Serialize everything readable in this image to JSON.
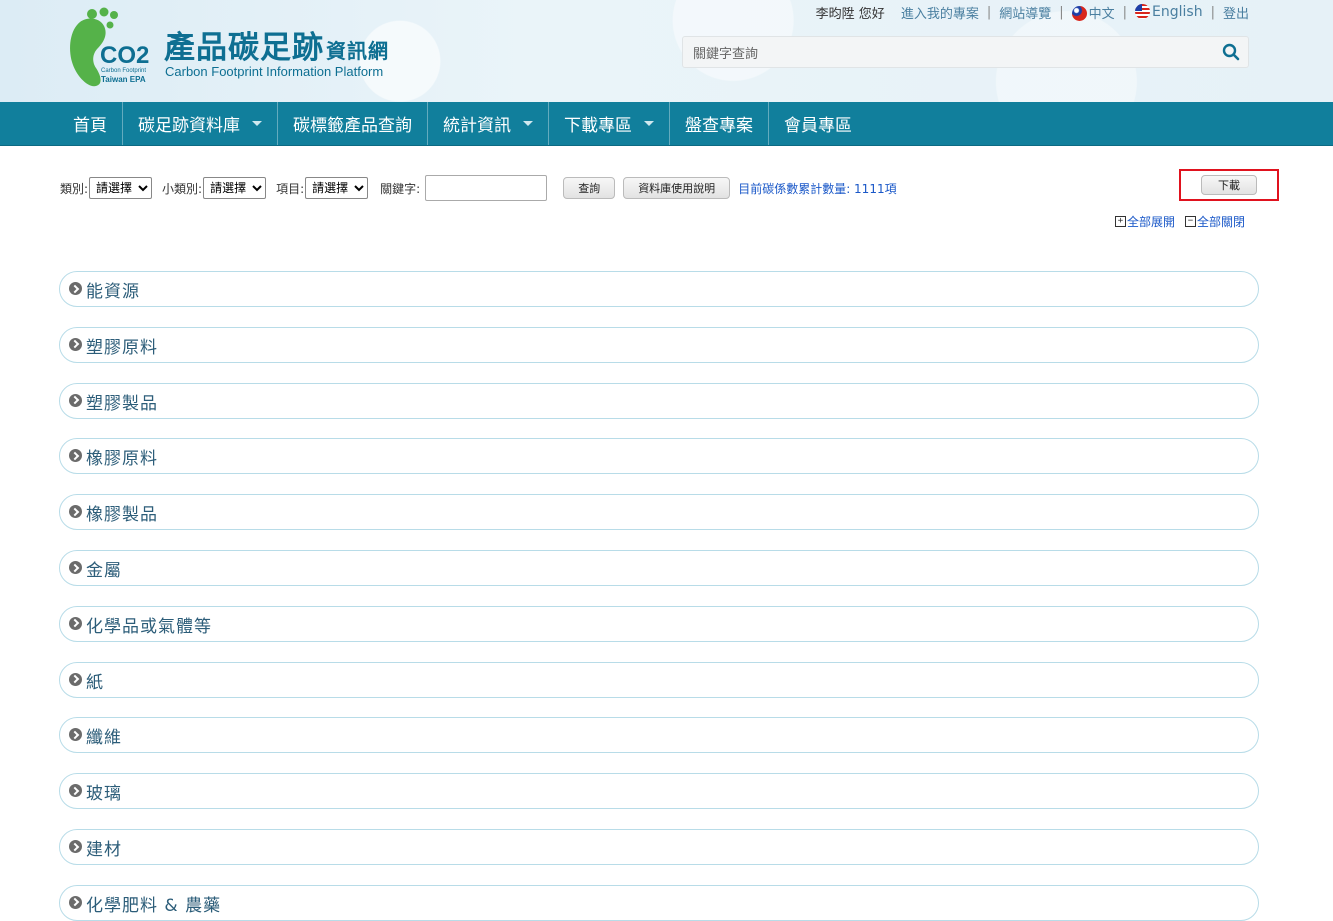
{
  "brand": {
    "title": "產品碳足跡",
    "title_suffix": "資訊網",
    "subtitle": "Carbon Footprint Information Platform",
    "logo_co2": "CO2",
    "logo_small1": "Carbon Footprint",
    "logo_small2": "Taiwan EPA"
  },
  "topnav": {
    "greeting": "李昀陞 您好",
    "my_project": "進入我的專案",
    "sitemap": "網站導覽",
    "chinese": "中文",
    "english": "English",
    "logout": "登出",
    "sep": "|"
  },
  "search": {
    "placeholder": "關鍵字查詢"
  },
  "mainnav": [
    {
      "label": "首頁",
      "dropdown": false
    },
    {
      "label": "碳足跡資料庫",
      "dropdown": true
    },
    {
      "label": "碳標籤產品查詢",
      "dropdown": false
    },
    {
      "label": "統計資訊",
      "dropdown": true
    },
    {
      "label": "下載專區",
      "dropdown": true
    },
    {
      "label": "盤查專案",
      "dropdown": false
    },
    {
      "label": "會員專區",
      "dropdown": false
    }
  ],
  "filters": {
    "category_label": "類別:",
    "subcategory_label": "小類別:",
    "item_label": "項目:",
    "keyword_label": "關鍵字:",
    "select_default": "請選擇",
    "query_button": "查詢",
    "manual_button": "資料庫使用說明",
    "count_text": "目前碳係數累計數量: 1111項"
  },
  "download_button": "下載",
  "expand_all": "全部展開",
  "collapse_all": "全部關閉",
  "categories": [
    "能資源",
    "塑膠原料",
    "塑膠製品",
    "橡膠原料",
    "橡膠製品",
    "金屬",
    "化學品或氣體等",
    "紙",
    "纖維",
    "玻璃",
    "建材",
    "化學肥料 & 農藥"
  ],
  "colors": {
    "nav_bg": "#117f9c",
    "brand_text": "#0e6f92",
    "link_blue": "#1a58c8",
    "highlight_red": "#e0121e"
  }
}
